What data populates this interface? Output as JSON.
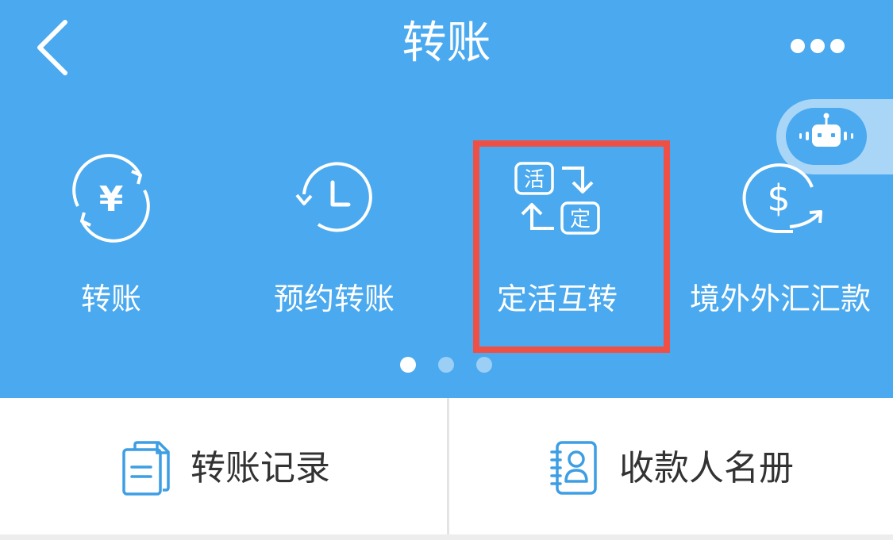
{
  "header": {
    "title": "转账",
    "back_icon": "chevron-left-icon",
    "more_icon": "more-dots-icon",
    "assistant_icon": "robot-icon"
  },
  "menu": {
    "items": [
      {
        "label": "转账",
        "icon": "yuan-exchange-icon"
      },
      {
        "label": "预约转账",
        "icon": "scheduled-clock-icon"
      },
      {
        "label": "定活互转",
        "icon": "fixed-current-swap-icon",
        "highlighted": true
      },
      {
        "label": "境外外汇汇款",
        "icon": "dollar-remit-icon"
      }
    ],
    "icon_text": {
      "current": "活",
      "fixed": "定",
      "yuan": "¥",
      "dollar": "$"
    },
    "page_indicator": {
      "pages": 3,
      "current": 1
    }
  },
  "bottom": {
    "records_label": "转账记录",
    "records_icon": "document-icon",
    "payees_label": "收款人名册",
    "payees_icon": "contact-book-icon"
  },
  "colors": {
    "primary": "#4aa9ef",
    "highlight_border": "#ef5046",
    "text_dark": "#333333",
    "icon_blue": "#3d9ee4"
  }
}
